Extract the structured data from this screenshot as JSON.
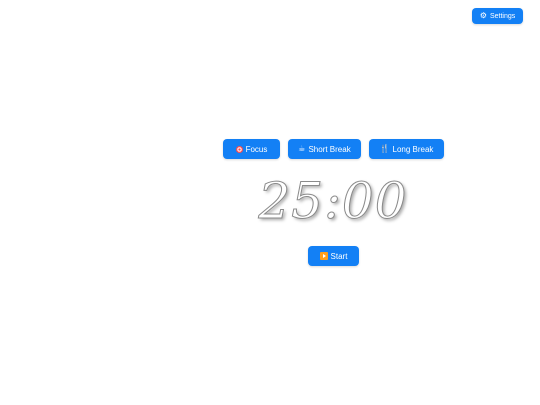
{
  "header": {
    "settings_icon": "gear-icon",
    "settings_label": "Settings"
  },
  "modes": {
    "focus": {
      "icon": "target-icon",
      "label": "Focus"
    },
    "short_break": {
      "icon": "coffee-icon",
      "label": "Short Break"
    },
    "long_break": {
      "icon": "fork-knife-icon",
      "label": "Long Break"
    }
  },
  "timer": {
    "display": "25:00"
  },
  "controls": {
    "start_icon": "play-icon",
    "start_label": "Start"
  },
  "colors": {
    "accent": "#1380f5",
    "background": "#ffffff"
  }
}
